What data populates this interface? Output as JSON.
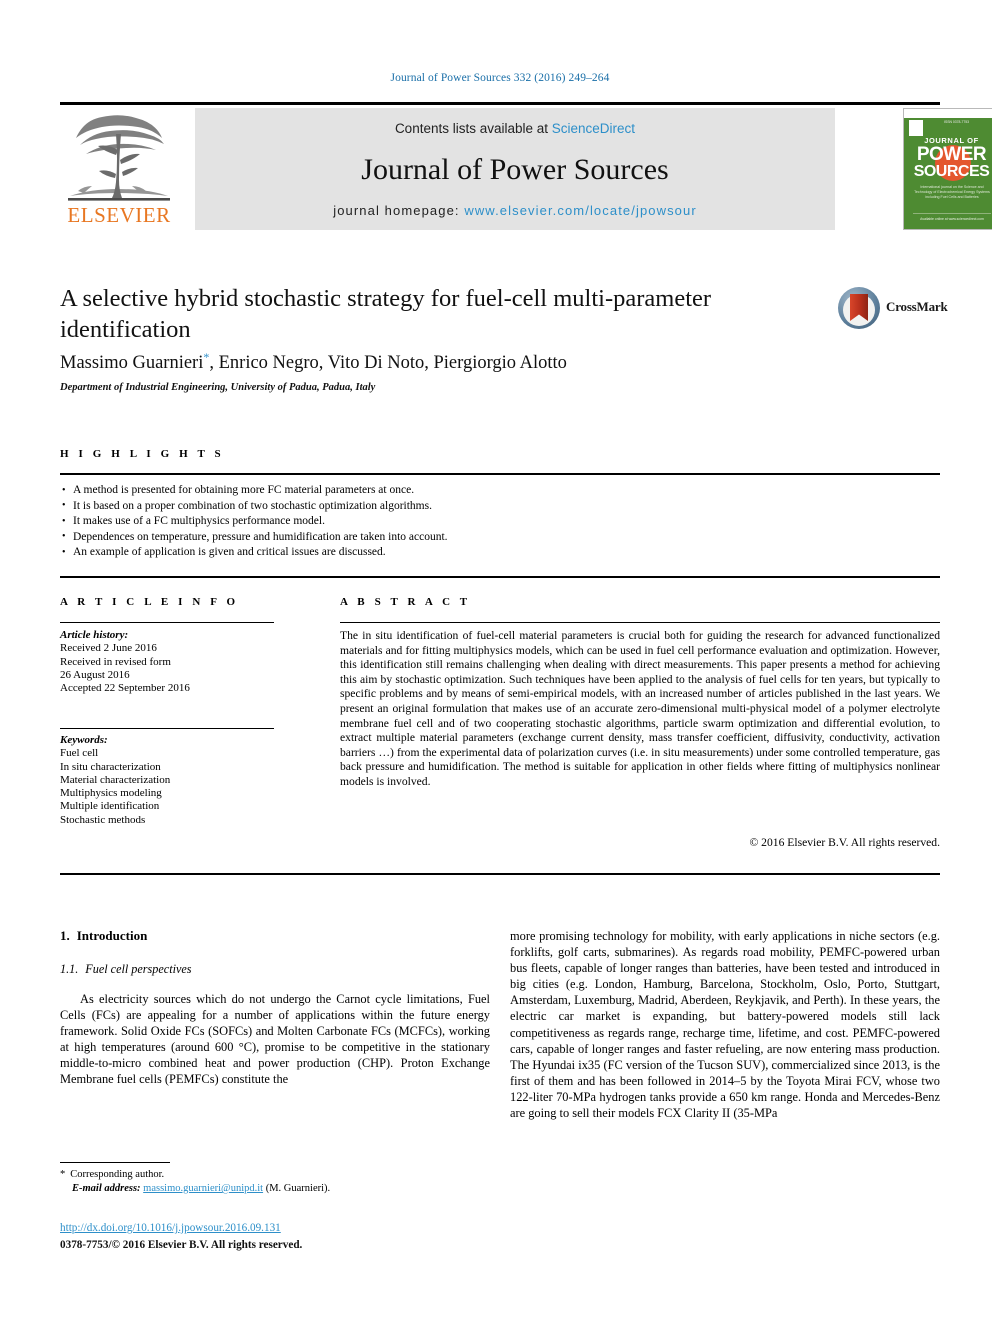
{
  "running_head": "Journal of Power Sources 332 (2016) 249–264",
  "masthead": {
    "contents_prefix": "Contents lists available at ",
    "sciencedirect": "ScienceDirect",
    "journal_name": "Journal of Power Sources",
    "homepage_prefix": "journal homepage: ",
    "homepage_url": "www.elsevier.com/locate/jpowsour",
    "publisher": "ELSEVIER",
    "cover": {
      "jof": "JOURNAL OF",
      "power": "POWER",
      "sources": "SOURCES",
      "blurb": "International journal on the Science and Technology of Electrochemical Energy Systems including Fuel Cells and Batteries",
      "foot": "Available online at www.sciencedirect.com",
      "issn": "ISSN 0378-7753"
    }
  },
  "article": {
    "title": "A selective hybrid stochastic strategy for fuel-cell multi-parameter identification",
    "authors": "Massimo Guarnieri",
    "authors_rest": ", Enrico Negro, Vito Di Noto, Piergiorgio Alotto",
    "affiliation": "Department of Industrial Engineering, University of Padua, Padua, Italy",
    "crossmark_label": "CrossMark"
  },
  "highlights": {
    "heading": "H I G H L I G H T S",
    "items": [
      "A method is presented for obtaining more FC material parameters at once.",
      "It is based on a proper combination of two stochastic optimization algorithms.",
      "It makes use of a FC multiphysics performance model.",
      "Dependences on temperature, pressure and humidification are taken into account.",
      "An example of application is given and critical issues are discussed."
    ]
  },
  "article_info": {
    "heading": "A R T I C L E   I N F O",
    "history_label": "Article history:",
    "history": [
      "Received 2 June 2016",
      "Received in revised form",
      "26 August 2016",
      "Accepted 22 September 2016"
    ],
    "keywords_label": "Keywords:",
    "keywords": [
      "Fuel cell",
      "In situ characterization",
      "Material characterization",
      "Multiphysics modeling",
      "Multiple identification",
      "Stochastic methods"
    ]
  },
  "abstract": {
    "heading": "A B S T R A C T",
    "text": "The in situ identification of fuel-cell material parameters is crucial both for guiding the research for advanced functionalized materials and for fitting multiphysics models, which can be used in fuel cell performance evaluation and optimization. However, this identification still remains challenging when dealing with direct measurements. This paper presents a method for achieving this aim by stochastic optimization. Such techniques have been applied to the analysis of fuel cells for ten years, but typically to specific problems and by means of semi-empirical models, with an increased number of articles published in the last years. We present an original formulation that makes use of an accurate zero-dimensional multi-physical model of a polymer electrolyte membrane fuel cell and of two cooperating stochastic algorithms, particle swarm optimization and differential evolution, to extract multiple material parameters (exchange current density, mass transfer coefficient, diffusivity, conductivity, activation barriers …) from the experimental data of polarization curves (i.e. in situ measurements) under some controlled temperature, gas back pressure and humidification. The method is suitable for application in other fields where fitting of multiphysics nonlinear models is involved.",
    "copyright": "© 2016 Elsevier B.V. All rights reserved."
  },
  "body": {
    "section_number": "1.",
    "section_title": "Introduction",
    "subsection_number": "1.1.",
    "subsection_title": "Fuel cell perspectives",
    "left_paragraph": "As electricity sources which do not undergo the Carnot cycle limitations, Fuel Cells (FCs) are appealing for a number of applications within the future energy framework. Solid Oxide FCs (SOFCs) and Molten Carbonate FCs (MCFCs), working at high temperatures (around 600 °C), promise to be competitive in the stationary middle-to-micro combined heat and power production (CHP). Proton Exchange Membrane fuel cells (PEMFCs) constitute the",
    "right_paragraph": "more promising technology for mobility, with early applications in niche sectors (e.g. forklifts, golf carts, submarines). As regards road mobility, PEMFC-powered urban bus fleets, capable of longer ranges than batteries, have been tested and introduced in big cities (e.g. London, Hamburg, Barcelona, Stockholm, Oslo, Porto, Stuttgart, Amsterdam, Luxemburg, Madrid, Aberdeen, Reykjavik, and Perth). In these years, the electric car market is expanding, but battery-powered models still lack competitiveness as regards range, recharge time, lifetime, and cost. PEMFC-powered cars, capable of longer ranges and faster refueling, are now entering mass production. The Hyundai ix35 (FC version of the Tucson SUV), commercialized since 2013, is the first of them and has been followed in 2014–5 by the Toyota Mirai FCV, whose two 122-liter 70-MPa hydrogen tanks provide a 650 km range. Honda and Mercedes-Benz are going to sell their models FCX Clarity II (35-MPa"
  },
  "footer": {
    "corresponding_marker": "*",
    "corresponding_label": "Corresponding author.",
    "email_label": "E-mail address:",
    "email": "massimo.guarnieri@unipd.it",
    "email_owner": "(M. Guarnieri).",
    "doi": "http://dx.doi.org/10.1016/j.jpowsour.2016.09.131",
    "issn_line": "0378-7753/© 2016 Elsevier B.V. All rights reserved."
  },
  "colors": {
    "link_blue": "#2d8fc9",
    "head_blue": "#1a6fa8",
    "elsevier_orange": "#e87722",
    "cover_green": "#4e8b32",
    "band_gray": "#e3e3e3"
  }
}
